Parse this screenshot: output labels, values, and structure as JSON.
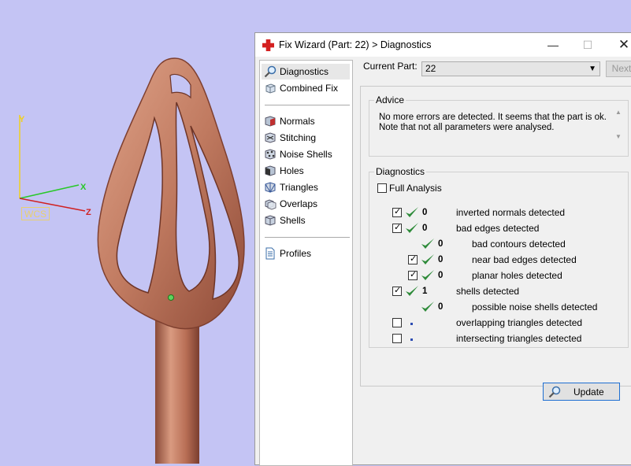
{
  "window": {
    "title": "Fix Wizard (Part: 22) > Diagnostics",
    "min_glyph": "—",
    "max_glyph": "☐",
    "close_glyph": "✕"
  },
  "viewport": {
    "wcs_label": "WCS",
    "axes": {
      "x": "X",
      "y": "Y",
      "z": "Z"
    },
    "colors": {
      "background": "#c4c4f4",
      "part": "#c48066",
      "x_axis": "#28c828",
      "y_axis": "#f0d020",
      "z_axis": "#d02020"
    },
    "icons": [
      "axis-triad-icon",
      "selection-point-icon"
    ]
  },
  "nav": {
    "items_top": [
      {
        "label": "Diagnostics",
        "icon": "magnifier-icon"
      },
      {
        "label": "Combined Fix",
        "icon": "cube-icon"
      }
    ],
    "items_mid": [
      {
        "label": "Normals",
        "icon": "normals-cube-icon"
      },
      {
        "label": "Stitching",
        "icon": "stitching-cube-icon"
      },
      {
        "label": "Noise Shells",
        "icon": "noise-shells-icon"
      },
      {
        "label": "Holes",
        "icon": "holes-cube-icon"
      },
      {
        "label": "Triangles",
        "icon": "triangles-cube-icon"
      },
      {
        "label": "Overlaps",
        "icon": "overlaps-cube-icon"
      },
      {
        "label": "Shells",
        "icon": "shells-cube-icon"
      }
    ],
    "items_bottom": [
      {
        "label": "Profiles",
        "icon": "document-icon"
      }
    ]
  },
  "current_part": {
    "label": "Current Part:",
    "value": "22",
    "next_label": "Next"
  },
  "advice": {
    "title": "Advice",
    "line1": "No more errors are detected. It seems that the part is ok.",
    "line2": "Note that not all parameters were analysed."
  },
  "diagnostics": {
    "title": "Diagnostics",
    "full_analysis_label": "Full Analysis",
    "full_analysis_checked": false,
    "rows": [
      {
        "checked": true,
        "status": "ok",
        "count": "0",
        "label": "inverted normals detected"
      },
      {
        "checked": true,
        "status": "ok",
        "count": "0",
        "label": "bad edges detected"
      },
      {
        "checked": null,
        "status": "ok",
        "count": "0",
        "label": "bad contours detected"
      },
      {
        "checked": true,
        "status": "ok",
        "count": "0",
        "label": "near bad edges detected"
      },
      {
        "checked": true,
        "status": "ok",
        "count": "0",
        "label": "planar holes detected"
      },
      {
        "checked": true,
        "status": "ok",
        "count": "1",
        "label": "shells detected"
      },
      {
        "checked": null,
        "status": "ok",
        "count": "0",
        "label": "possible noise shells detected"
      },
      {
        "checked": false,
        "status": "not-run",
        "count": "",
        "label": "overlapping triangles detected"
      },
      {
        "checked": false,
        "status": "not-run",
        "count": "",
        "label": "intersecting triangles detected"
      }
    ],
    "colors": {
      "tick": "#2e8b3a",
      "not_run_dot": "#2d4db3",
      "update_border": "#1e6fd2"
    },
    "update_label": "Update"
  }
}
